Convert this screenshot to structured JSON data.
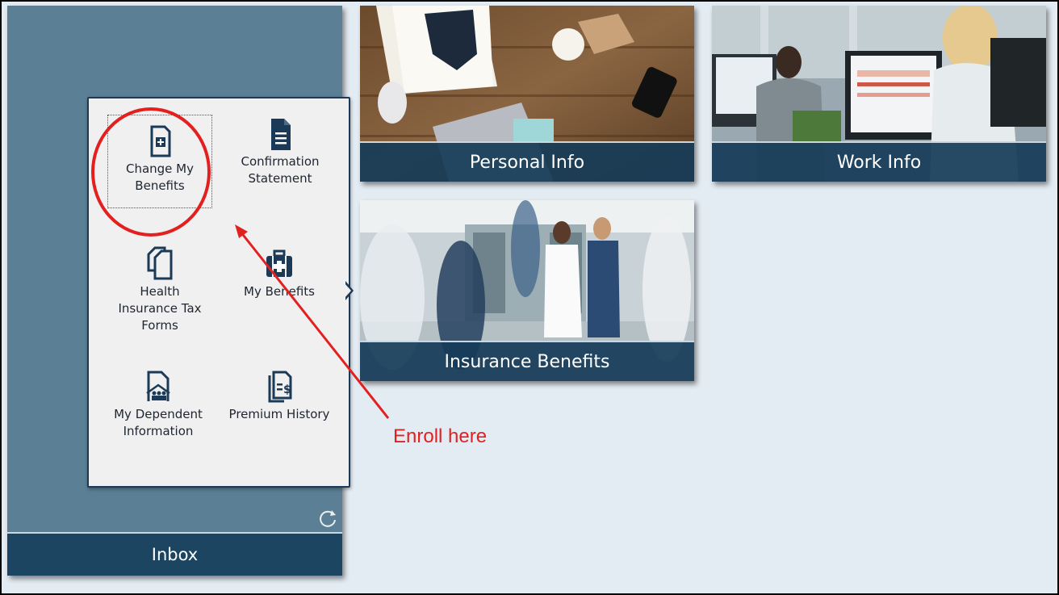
{
  "inbox": {
    "label": "Inbox"
  },
  "menu": {
    "items": [
      {
        "id": "change-my-benefits",
        "label": "Change My Benefits"
      },
      {
        "id": "confirmation-statement",
        "label": "Confirmation Statement"
      },
      {
        "id": "health-insurance-tax-forms",
        "label": "Health Insurance Tax Forms"
      },
      {
        "id": "my-benefits",
        "label": "My Benefits"
      },
      {
        "id": "my-dependent-information",
        "label": "My Dependent Information"
      },
      {
        "id": "premium-history",
        "label": "Premium History"
      }
    ]
  },
  "tiles": {
    "personal_info": "Personal Info",
    "work_info": "Work Info",
    "insurance_benefits": "Insurance Benefits"
  },
  "annotation": {
    "text": "Enroll here",
    "color": "#e32020"
  },
  "icons": {
    "refresh": "refresh-icon",
    "change_benefits": "document-plus-icon",
    "confirmation": "document-lines-icon",
    "tax_forms": "documents-copy-icon",
    "my_benefits": "medical-kit-icon",
    "dependent": "family-document-icon",
    "premium": "document-dollar-icon"
  },
  "colors": {
    "accent": "#1b4561",
    "background": "#e4ecf3",
    "sidebar": "#5b7f94"
  }
}
